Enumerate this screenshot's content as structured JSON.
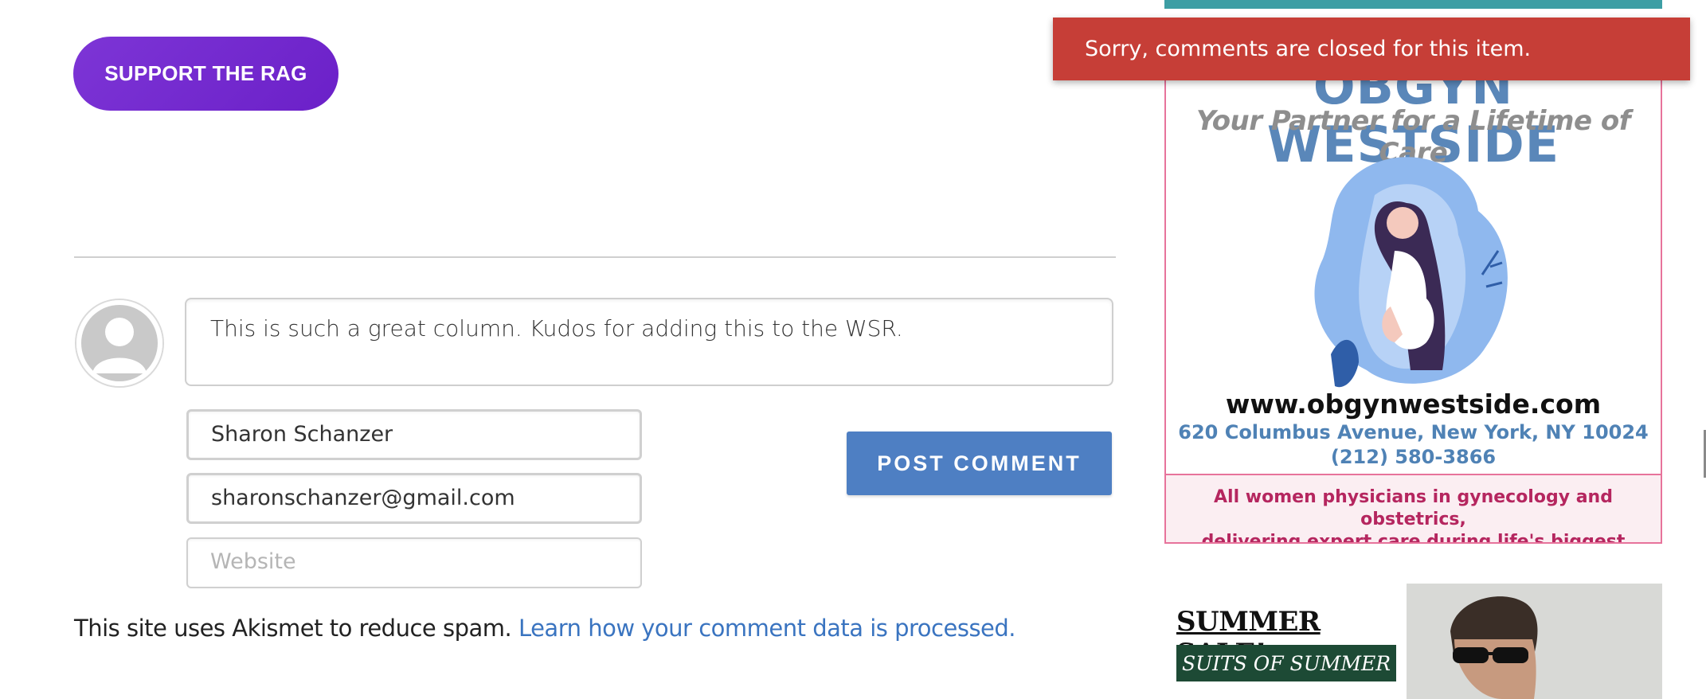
{
  "support_button": {
    "label": "SUPPORT THE RAG"
  },
  "comment_form": {
    "comment_text": "This is such a great column. Kudos for adding this to the WSR.",
    "name_value": "Sharon Schanzer",
    "email_value": "sharonschanzer@gmail.com",
    "website_placeholder": "Website",
    "post_button": "POST COMMENT"
  },
  "akismet": {
    "text": "This site uses Akismet to reduce spam.",
    "link": "Learn how your comment data is processed."
  },
  "toast": {
    "message": "Sorry, comments are closed for this item."
  },
  "ad_obgyn": {
    "title": "OBGYN WESTSIDE",
    "tagline": "Your Partner for a Lifetime of Care",
    "url": "www.obgynwestside.com",
    "address": "620 Columbus Avenue, New York, NY 10024",
    "phone": "(212) 580-3866",
    "footer_line1": "All women physicians in gynecology and obstetrics,",
    "footer_line2": "delivering expert care during life's biggest journey."
  },
  "ad_summer": {
    "headline": "SUMMER SALE!",
    "subline": "SUITS OF SUMMER"
  },
  "colors": {
    "support_purple": "#7229cf",
    "post_blue": "#4e7fc3",
    "toast_red": "#c63e37",
    "link_blue": "#3a74c0",
    "ad_border_pink": "#e7739b",
    "teal": "#3d9ea4"
  }
}
